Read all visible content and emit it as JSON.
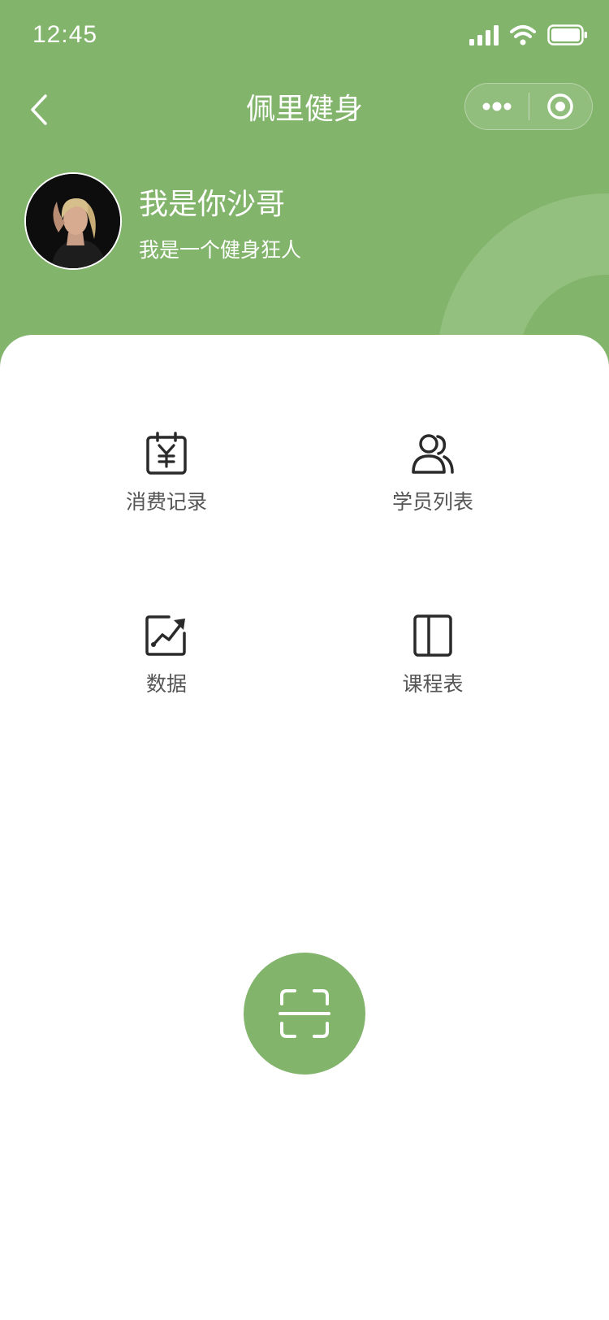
{
  "status_bar": {
    "time": "12:45",
    "icons": [
      "signal-icon",
      "wifi-icon",
      "battery-icon"
    ]
  },
  "nav": {
    "title": "佩里健身",
    "back_icon": "chevron-left-icon",
    "capsule_icons": [
      "more-dots-icon",
      "target-circle-icon"
    ]
  },
  "profile": {
    "name": "我是你沙哥",
    "bio": "我是一个健身狂人"
  },
  "menu": [
    {
      "label": "消费记录",
      "icon": "calendar-yen-icon"
    },
    {
      "label": "学员列表",
      "icon": "users-icon"
    },
    {
      "label": "数据",
      "icon": "trend-chart-icon"
    },
    {
      "label": "课程表",
      "icon": "schedule-panel-icon"
    }
  ],
  "scan_button": {
    "icon": "scan-icon"
  },
  "colors": {
    "primary": "#82b46b",
    "decor": "#93c07e",
    "text_gray": "#555555",
    "icon_dark": "#2a2a2a"
  }
}
